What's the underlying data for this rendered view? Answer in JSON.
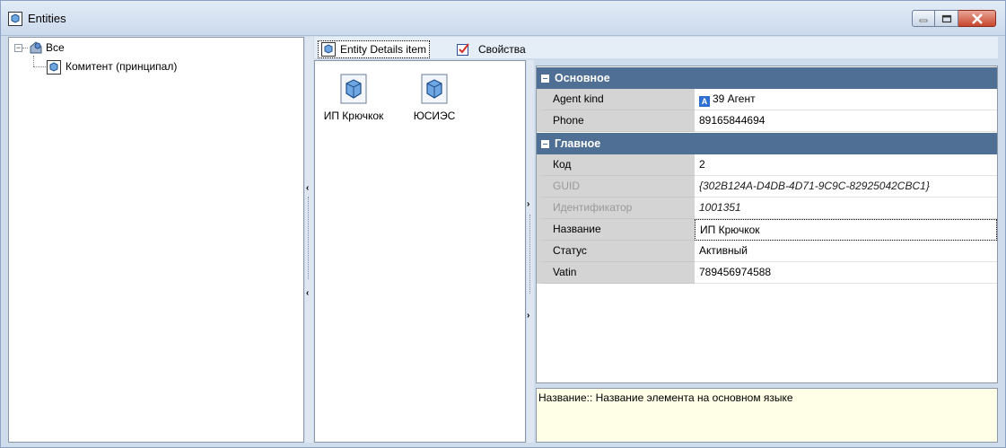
{
  "window": {
    "title": "Entities"
  },
  "tree": {
    "root_label": "Все",
    "child_label": "Комитент (принципал)"
  },
  "tabs": [
    {
      "label": "Entity Details item",
      "icon": "entity-icon"
    },
    {
      "label": "Свойства",
      "icon": "properties-icon"
    }
  ],
  "items": [
    {
      "label": "ИП Крючкок",
      "icon": "entity-cube-icon"
    },
    {
      "label": "ЮСИЭС",
      "icon": "entity-cube-icon"
    }
  ],
  "properties": {
    "sections": [
      {
        "title": "Основное"
      },
      {
        "title": "Главное"
      }
    ],
    "rows": [
      {
        "name": "Agent kind",
        "value": "39 Агент",
        "badge": "A"
      },
      {
        "name": "Phone",
        "value": "89165844694"
      },
      {
        "name": "Код",
        "value": "2"
      },
      {
        "name": "GUID",
        "value": "{302B124A-D4DB-4D71-9C9C-82925042CBC1}"
      },
      {
        "name": "Идентификатор",
        "value": "1001351"
      },
      {
        "name": "Название",
        "value": "ИП Крючкок"
      },
      {
        "name": "Статус",
        "value": "Активный"
      },
      {
        "name": "Vatin",
        "value": "789456974588"
      }
    ]
  },
  "description": "Название:: Название элемента на основном языке",
  "colors": {
    "section_header": "#4f6f94",
    "description_bg": "#fffee6",
    "close_button": "#c7472e"
  }
}
